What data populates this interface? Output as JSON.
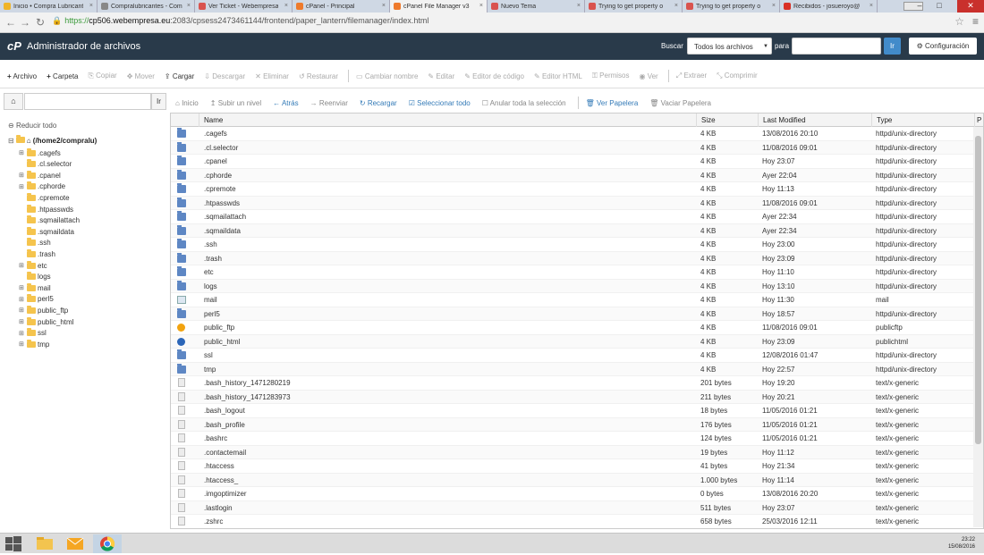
{
  "browser": {
    "tabs": [
      {
        "label": "Inicio • Compra Lubricant",
        "icon_color": "#f0b428",
        "active": false
      },
      {
        "label": "Compralubricantes - Com",
        "icon_color": "#888888",
        "active": false
      },
      {
        "label": "Ver Ticket - Webempresa",
        "icon_color": "#d9534f",
        "active": false
      },
      {
        "label": "cPanel - Principal",
        "icon_color": "#ee7a2c",
        "active": false
      },
      {
        "label": "cPanel File Manager v3",
        "icon_color": "#ee7a2c",
        "active": true
      },
      {
        "label": "Nuevo Tema",
        "icon_color": "#d9534f",
        "active": false
      },
      {
        "label": "Trying to get property o",
        "icon_color": "#d9534f",
        "active": false
      },
      {
        "label": "Trying to get property o",
        "icon_color": "#d9534f",
        "active": false
      },
      {
        "label": "Recibidos - josueroyo@",
        "icon_color": "#d93025",
        "active": false
      }
    ],
    "url_https": "https://",
    "url_host": "cp506.webempresa.eu",
    "url_rest": ":2083/cpsess2473461144/frontend/paper_lantern/filemanager/index.html"
  },
  "header": {
    "logo": "cP",
    "title": "Administrador de archivos",
    "search_label": "Buscar",
    "search_scope": "Todos los archivos",
    "for_label": "para",
    "go_label": "Ir",
    "settings_label": "Configuración"
  },
  "toolbar": {
    "archivo": "Archivo",
    "carpeta": "Carpeta",
    "copiar": "Copiar",
    "mover": "Mover",
    "cargar": "Cargar",
    "descargar": "Descargar",
    "eliminar": "Eliminar",
    "restaurar": "Restaurar",
    "cambiar_nombre": "Cambiar nombre",
    "editar": "Editar",
    "editor_codigo": "Editor de código",
    "editor_html": "Editor HTML",
    "permisos": "Permisos",
    "ver": "Ver",
    "extraer": "Extraer",
    "comprimir": "Comprimir"
  },
  "nav": {
    "go_label": "Ir",
    "inicio": "Inicio",
    "subir": "Subir un nivel",
    "atras": "Atrás",
    "reenviar": "Reenviar",
    "recargar": "Recargar",
    "seleccionar": "Seleccionar todo",
    "anular": "Anular toda la selección",
    "ver_papelera": "Ver Papelera",
    "vaciar_papelera": "Vaciar Papelera"
  },
  "tree": {
    "collapse_label": "Reducir todo",
    "root_label": "(/home2/compralu)",
    "items": [
      {
        "name": ".cagefs",
        "expandable": true
      },
      {
        "name": ".cl.selector",
        "expandable": false
      },
      {
        "name": ".cpanel",
        "expandable": true
      },
      {
        "name": ".cphorde",
        "expandable": true
      },
      {
        "name": ".cpremote",
        "expandable": false
      },
      {
        "name": ".htpasswds",
        "expandable": false
      },
      {
        "name": ".sqmailattach",
        "expandable": false
      },
      {
        "name": ".sqmaildata",
        "expandable": false
      },
      {
        "name": ".ssh",
        "expandable": false
      },
      {
        "name": ".trash",
        "expandable": false
      },
      {
        "name": "etc",
        "expandable": true
      },
      {
        "name": "logs",
        "expandable": false
      },
      {
        "name": "mail",
        "expandable": true
      },
      {
        "name": "perl5",
        "expandable": true
      },
      {
        "name": "public_ftp",
        "expandable": true
      },
      {
        "name": "public_html",
        "expandable": true
      },
      {
        "name": "ssl",
        "expandable": true
      },
      {
        "name": "tmp",
        "expandable": true
      }
    ]
  },
  "table": {
    "headers": {
      "name": "Name",
      "size": "Size",
      "modified": "Last Modified",
      "type": "Type",
      "perm": "P"
    },
    "rows": [
      {
        "icon": "dir",
        "name": ".cagefs",
        "size": "4 KB",
        "modified": "13/08/2016 20:10",
        "type": "httpd/unix-directory"
      },
      {
        "icon": "dir",
        "name": ".cl.selector",
        "size": "4 KB",
        "modified": "11/08/2016 09:01",
        "type": "httpd/unix-directory"
      },
      {
        "icon": "dir",
        "name": ".cpanel",
        "size": "4 KB",
        "modified": "Hoy 23:07",
        "type": "httpd/unix-directory"
      },
      {
        "icon": "dir",
        "name": ".cphorde",
        "size": "4 KB",
        "modified": "Ayer 22:04",
        "type": "httpd/unix-directory"
      },
      {
        "icon": "dir",
        "name": ".cpremote",
        "size": "4 KB",
        "modified": "Hoy 11:13",
        "type": "httpd/unix-directory"
      },
      {
        "icon": "dir",
        "name": ".htpasswds",
        "size": "4 KB",
        "modified": "11/08/2016 09:01",
        "type": "httpd/unix-directory"
      },
      {
        "icon": "dir",
        "name": ".sqmailattach",
        "size": "4 KB",
        "modified": "Ayer 22:34",
        "type": "httpd/unix-directory"
      },
      {
        "icon": "dir",
        "name": ".sqmaildata",
        "size": "4 KB",
        "modified": "Ayer 22:34",
        "type": "httpd/unix-directory"
      },
      {
        "icon": "dir",
        "name": ".ssh",
        "size": "4 KB",
        "modified": "Hoy 23:00",
        "type": "httpd/unix-directory"
      },
      {
        "icon": "dir",
        "name": ".trash",
        "size": "4 KB",
        "modified": "Hoy 23:09",
        "type": "httpd/unix-directory"
      },
      {
        "icon": "dir",
        "name": "etc",
        "size": "4 KB",
        "modified": "Hoy 11:10",
        "type": "httpd/unix-directory"
      },
      {
        "icon": "dir",
        "name": "logs",
        "size": "4 KB",
        "modified": "Hoy 13:10",
        "type": "httpd/unix-directory"
      },
      {
        "icon": "mail",
        "name": "mail",
        "size": "4 KB",
        "modified": "Hoy 11:30",
        "type": "mail"
      },
      {
        "icon": "dir",
        "name": "perl5",
        "size": "4 KB",
        "modified": "Hoy 18:57",
        "type": "httpd/unix-directory"
      },
      {
        "icon": "pub",
        "name": "public_ftp",
        "size": "4 KB",
        "modified": "11/08/2016 09:01",
        "type": "publicftp"
      },
      {
        "icon": "web",
        "name": "public_html",
        "size": "4 KB",
        "modified": "Hoy 23:09",
        "type": "publichtml"
      },
      {
        "icon": "dir",
        "name": "ssl",
        "size": "4 KB",
        "modified": "12/08/2016 01:47",
        "type": "httpd/unix-directory"
      },
      {
        "icon": "dir",
        "name": "tmp",
        "size": "4 KB",
        "modified": "Hoy 22:57",
        "type": "httpd/unix-directory"
      },
      {
        "icon": "txt",
        "name": ".bash_history_1471280219",
        "size": "201 bytes",
        "modified": "Hoy 19:20",
        "type": "text/x-generic"
      },
      {
        "icon": "txt",
        "name": ".bash_history_1471283973",
        "size": "211 bytes",
        "modified": "Hoy 20:21",
        "type": "text/x-generic"
      },
      {
        "icon": "txt",
        "name": ".bash_logout",
        "size": "18 bytes",
        "modified": "11/05/2016 01:21",
        "type": "text/x-generic"
      },
      {
        "icon": "txt",
        "name": ".bash_profile",
        "size": "176 bytes",
        "modified": "11/05/2016 01:21",
        "type": "text/x-generic"
      },
      {
        "icon": "txt",
        "name": ".bashrc",
        "size": "124 bytes",
        "modified": "11/05/2016 01:21",
        "type": "text/x-generic"
      },
      {
        "icon": "txt",
        "name": ".contactemail",
        "size": "19 bytes",
        "modified": "Hoy 11:12",
        "type": "text/x-generic"
      },
      {
        "icon": "txt",
        "name": ".htaccess",
        "size": "41 bytes",
        "modified": "Hoy 21:34",
        "type": "text/x-generic"
      },
      {
        "icon": "txt",
        "name": ".htaccess_",
        "size": "1.000 bytes",
        "modified": "Hoy 11:14",
        "type": "text/x-generic"
      },
      {
        "icon": "txt",
        "name": ".imgoptimizer",
        "size": "0 bytes",
        "modified": "13/08/2016 20:20",
        "type": "text/x-generic"
      },
      {
        "icon": "txt",
        "name": ".lastlogin",
        "size": "511 bytes",
        "modified": "Hoy 23:07",
        "type": "text/x-generic"
      },
      {
        "icon": "txt",
        "name": ".zshrc",
        "size": "658 bytes",
        "modified": "25/03/2016 12:11",
        "type": "text/x-generic"
      }
    ]
  },
  "taskbar": {
    "time": "23:22",
    "date": "15/08/2016"
  }
}
